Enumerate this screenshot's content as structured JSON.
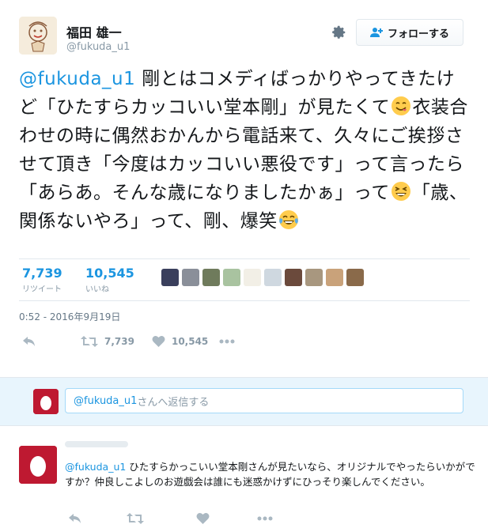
{
  "tweet": {
    "author_name": "福田 雄一",
    "author_handle": "@fukuda_u1",
    "follow_label": "フォローする",
    "text_mention": "@fukuda_u1",
    "text_part1": " 剛とはコメディばっかりやってきたけど「ひたすらカッコいい堂本剛」が見たくて",
    "text_part2": "衣装合わせの時に偶然おかんから電話来て、久々にご挨拶させて頂き「今度はカッコいい悪役です」って言ったら「あらあ。そんな歳になりましたかぁ」って",
    "text_part3": "「歳、関係ないやろ」って、剛、爆笑",
    "emoji1": "yum-face-icon",
    "emoji2": "laughing-face-icon",
    "emoji3": "tears-of-joy-icon",
    "retweets_count": "7,739",
    "retweets_label": "リツイート",
    "likes_count": "10,545",
    "likes_label": "いいね",
    "timestamp": "0:52 - 2016年9月19日",
    "action_retweet_count": "7,739",
    "action_like_count": "10,545",
    "liker_colors": [
      "#3a3f5c",
      "#8a8f99",
      "#6f7b5c",
      "#a9c3a0",
      "#f2efe6",
      "#cfd8e0",
      "#6b4a3c",
      "#a8977f",
      "#c9a27a",
      "#8a6a4a"
    ]
  },
  "reply_box": {
    "mention": "@fukuda_u1",
    "placeholder_suffix": "さんへ返信する"
  },
  "reply": {
    "mention": "@fukuda_u1",
    "text": " ひたすらかっこいい堂本剛さんが見たいなら、オリジナルでやったらいかがですか？仲良しこよしのお遊戯会は誰にも迷惑かけずにひっそり楽しんでください。"
  },
  "colors": {
    "accent": "#1b95e0",
    "muted": "#8899a6",
    "egg": "#be1931",
    "reply_band": "#e8f5fd"
  }
}
